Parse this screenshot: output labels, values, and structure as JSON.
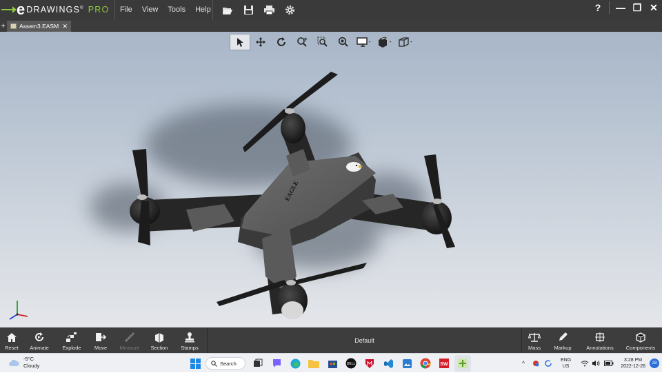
{
  "app": {
    "logo_letter": "e",
    "logo_name": "DRAWINGS",
    "logo_mark": "®",
    "logo_edition": "PRO"
  },
  "menu": [
    "File",
    "View",
    "Tools",
    "Help"
  ],
  "window_controls": {
    "help": "?",
    "minimize": "—",
    "restore": "❐",
    "close": "✕"
  },
  "tab": {
    "add": "+",
    "label": "Assem3.EASM",
    "close": "✕"
  },
  "bottom_toolbar": {
    "left": [
      {
        "label": "Reset",
        "icon": "home-icon",
        "enabled": true
      },
      {
        "label": "Animate",
        "icon": "animate-icon",
        "enabled": true
      },
      {
        "label": "Explode",
        "icon": "explode-icon",
        "enabled": true
      },
      {
        "label": "Move",
        "icon": "move-component-icon",
        "enabled": true
      },
      {
        "label": "Measure",
        "icon": "measure-icon",
        "enabled": false
      },
      {
        "label": "Section",
        "icon": "section-icon",
        "enabled": true
      },
      {
        "label": "Stamps",
        "icon": "stamp-icon",
        "enabled": true
      }
    ],
    "configuration": "Default",
    "right": [
      {
        "label": "Mass",
        "icon": "scale-icon"
      },
      {
        "label": "Markup",
        "icon": "pen-icon"
      },
      {
        "label": "Annotations",
        "icon": "annotations-icon"
      },
      {
        "label": "Components",
        "icon": "components-icon"
      }
    ]
  },
  "model": {
    "decal": "EAGLE",
    "colors": {
      "body": "#5f5f5f",
      "arms": "#262626",
      "props": "#1c1c1c"
    }
  },
  "taskbar": {
    "weather_temp": "-5°C",
    "weather_cond": "Cloudy",
    "search": "Search",
    "lang": "ENG",
    "region": "US",
    "time": "3:28 PM",
    "date": "2022-12-26",
    "notifications": "28"
  },
  "colors": {
    "accent": "#8cc63f",
    "chrome": "#3c3c3c"
  }
}
